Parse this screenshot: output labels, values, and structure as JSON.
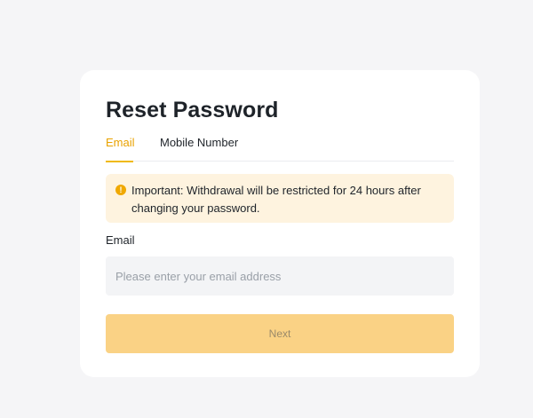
{
  "reset": {
    "title": "Reset Password",
    "tabs": [
      {
        "label": "Email",
        "active": true
      },
      {
        "label": "Mobile Number",
        "active": false
      }
    ],
    "notice": {
      "text": "Important: Withdrawal will be restricted for 24 hours after changing your password.",
      "icon": "exclamation-circle-icon"
    },
    "email_label": "Email",
    "email_value": "",
    "email_placeholder": "Please enter your email address",
    "next_label": "Next"
  },
  "colors": {
    "accent": "#f0b90b",
    "notice_bg": "#fef3df",
    "button_bg": "#fad285",
    "input_bg": "#f3f4f6"
  }
}
